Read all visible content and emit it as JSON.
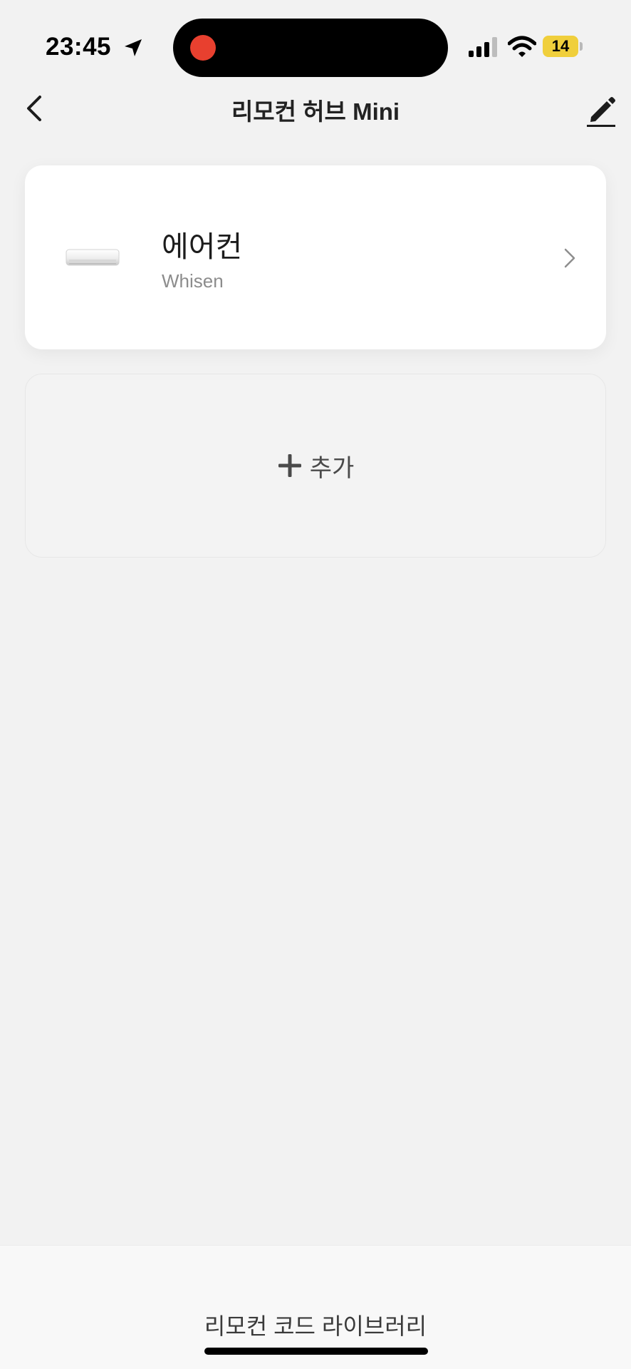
{
  "status_bar": {
    "time": "23:45",
    "battery": "14",
    "recording_color": "#e8402f",
    "battery_color": "#f0cf3c"
  },
  "header": {
    "title": "리모컨 허브 Mini",
    "back_icon": "chevron-left-icon",
    "edit_icon": "pencil-icon"
  },
  "devices": [
    {
      "name": "에어컨",
      "brand": "Whisen",
      "icon": "air-conditioner-icon"
    }
  ],
  "add_card": {
    "label": "추가",
    "icon": "plus-icon"
  },
  "footer": {
    "library_label": "리모컨 코드 라이브러리"
  }
}
